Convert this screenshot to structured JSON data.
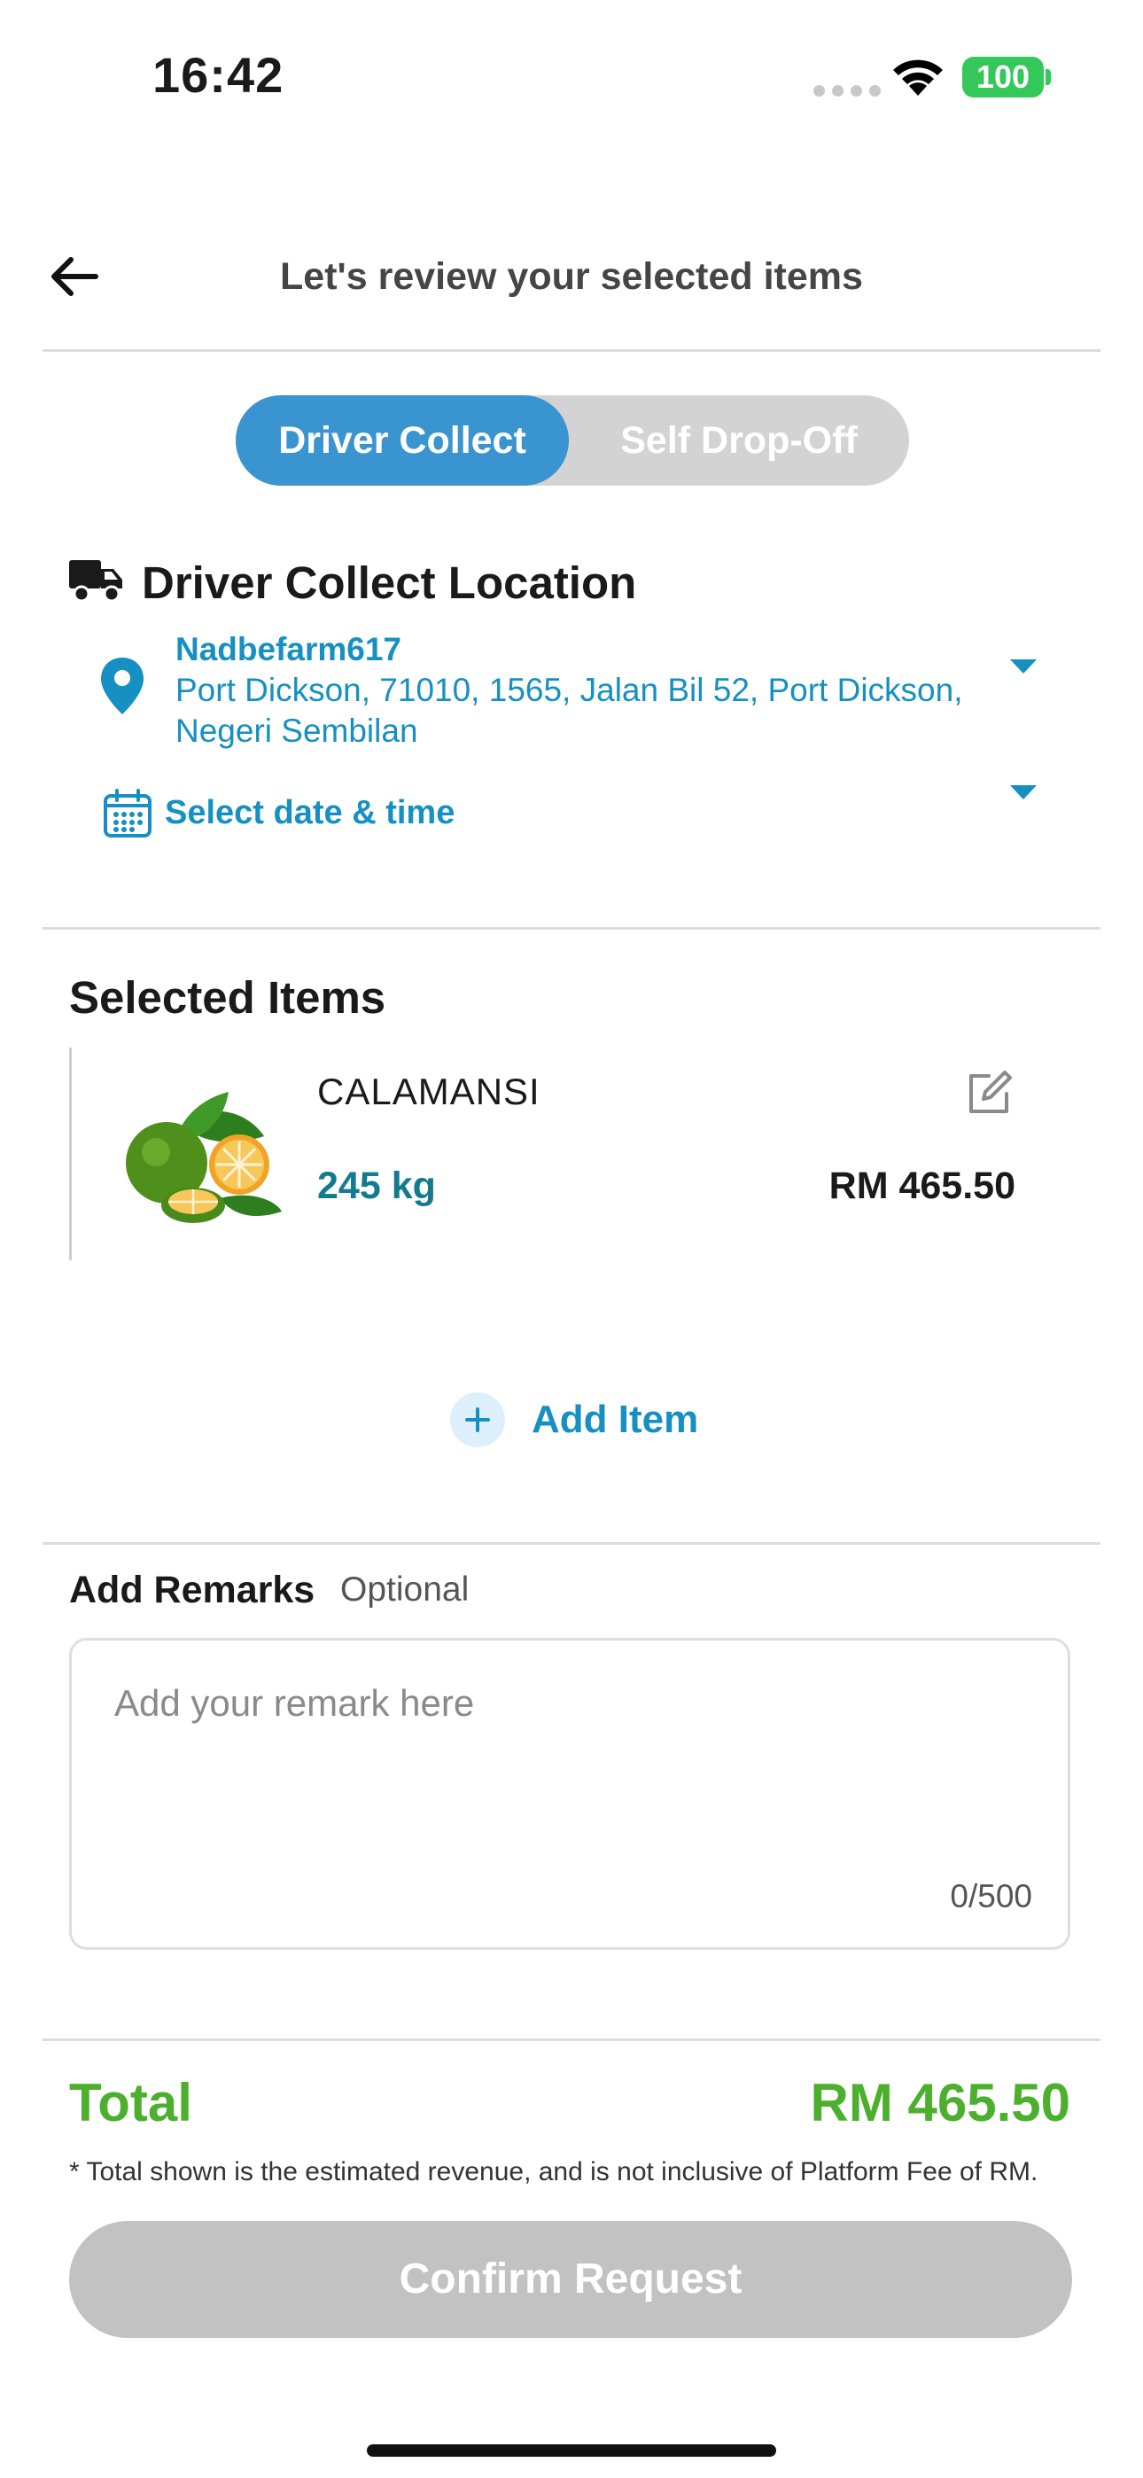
{
  "status_bar": {
    "time": "16:42",
    "battery": "100"
  },
  "header": {
    "title": "Let's review your selected items"
  },
  "segmented": {
    "active": "Driver Collect",
    "inactive": "Self Drop-Off"
  },
  "location": {
    "section_title": "Driver Collect Location",
    "name": "Nadbefarm617",
    "address": "Port Dickson, 71010, 1565, Jalan Bil 52, Port Dickson, Negeri Sembilan",
    "date_label": "Select date & time"
  },
  "selected_items": {
    "title": "Selected Items",
    "items": [
      {
        "name": "CALAMANSI",
        "quantity": "245 kg",
        "price": "RM 465.50"
      }
    ],
    "add_label": "Add Item"
  },
  "remarks": {
    "title": "Add Remarks",
    "optional": "Optional",
    "placeholder": "Add your remark here",
    "value": "",
    "counter": "0/500"
  },
  "summary": {
    "total_label": "Total",
    "total_value": "RM 465.50",
    "note": "* Total shown is the estimated revenue, and is not inclusive of Platform Fee of RM."
  },
  "actions": {
    "confirm": "Confirm Request"
  },
  "colors": {
    "primary_blue": "#1690c2",
    "segment_active": "#3a94cf",
    "total_green": "#4caf2e",
    "qty_teal": "#147a8e",
    "disabled_button": "#c2c2c2"
  }
}
